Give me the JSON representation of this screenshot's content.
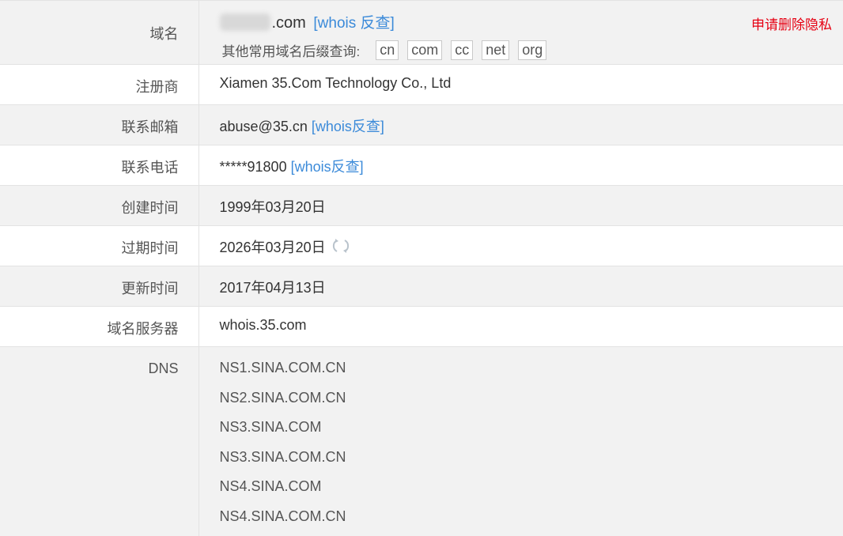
{
  "domain_row": {
    "label": "域名",
    "domain_suffix": ".com",
    "whois_reverse": "[whois 反查]",
    "privacy_link": "申请删除隐私",
    "suffix_prefix": "其他常用域名后缀查询:",
    "suffixes": [
      "cn",
      "com",
      "cc",
      "net",
      "org"
    ]
  },
  "registrar": {
    "label": "注册商",
    "value": "Xiamen 35.Com Technology Co., Ltd"
  },
  "email": {
    "label": "联系邮箱",
    "value": "abuse@35.cn",
    "link": "[whois反查]"
  },
  "phone": {
    "label": "联系电话",
    "value": "*****91800",
    "link": "[whois反查]"
  },
  "created": {
    "label": "创建时间",
    "value": "1999年03月20日"
  },
  "expires": {
    "label": "过期时间",
    "value": "2026年03月20日"
  },
  "updated": {
    "label": "更新时间",
    "value": "2017年04月13日"
  },
  "whois_server": {
    "label": "域名服务器",
    "value": "whois.35.com"
  },
  "dns": {
    "label": "DNS",
    "servers": [
      "NS1.SINA.COM.CN",
      "NS2.SINA.COM.CN",
      "NS3.SINA.COM",
      "NS3.SINA.COM.CN",
      "NS4.SINA.COM",
      "NS4.SINA.COM.CN"
    ]
  },
  "colors": {
    "link": "#3b8ad9",
    "privacy": "#e60012",
    "row_alt": "#f2f2f2"
  },
  "icons": {
    "refresh": "refresh-icon"
  }
}
